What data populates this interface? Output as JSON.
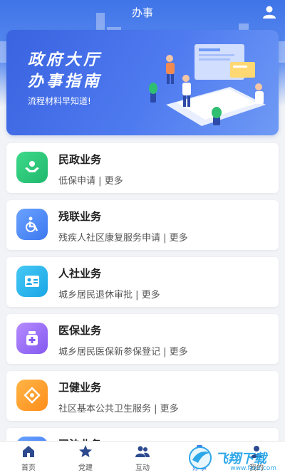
{
  "header": {
    "title": "办事"
  },
  "banner": {
    "line1": "政府大厅",
    "line2": "办事指南",
    "subtitle": "流程材料早知道!"
  },
  "services": [
    {
      "title": "民政业务",
      "subtitle": "低保申请 | 更多",
      "color_from": "#3fd98a",
      "color_to": "#1fb86d",
      "icon": "hands-icon"
    },
    {
      "title": "残联业务",
      "subtitle": "残疾人社区康复服务申请 | 更多",
      "color_from": "#6aa2ff",
      "color_to": "#3c78f0",
      "icon": "wheelchair-icon"
    },
    {
      "title": "人社业务",
      "subtitle": "城乡居民退休审批 | 更多",
      "color_from": "#46c8f5",
      "color_to": "#1aa6e6",
      "icon": "id-card-icon"
    },
    {
      "title": "医保业务",
      "subtitle": "城乡居民医保新参保登记 | 更多",
      "color_from": "#b58cff",
      "color_to": "#8458f0",
      "icon": "medicine-icon"
    },
    {
      "title": "卫健业务",
      "subtitle": "社区基本公共卫生服务 | 更多",
      "color_from": "#ffb547",
      "color_to": "#ff8d1a",
      "icon": "health-icon"
    },
    {
      "title": "司法业务",
      "subtitle": "",
      "color_from": "#6aa2ff",
      "color_to": "#3c78f0",
      "icon": "scale-icon"
    }
  ],
  "tabs": [
    {
      "label": "首页",
      "icon": "home-icon"
    },
    {
      "label": "党建",
      "icon": "star-icon"
    },
    {
      "label": "互动",
      "icon": "people-icon"
    },
    {
      "label": "办事",
      "icon": "briefcase-icon"
    },
    {
      "label": "我的",
      "icon": "user-icon"
    }
  ],
  "watermark": {
    "text": "飞翔下载",
    "url": "www.fxxz.com"
  },
  "colors": {
    "primary": "#3f74e8",
    "background": "#f1f3f7"
  }
}
